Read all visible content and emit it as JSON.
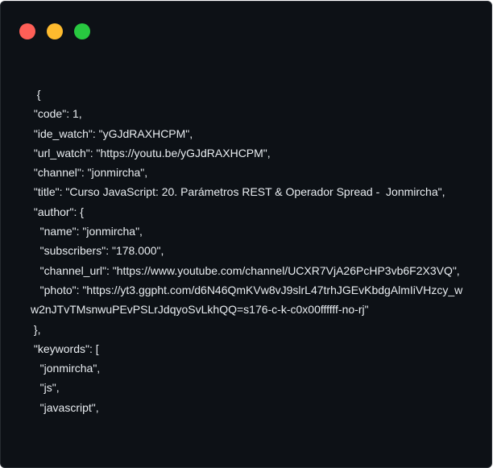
{
  "window": {
    "controls": [
      {
        "name": "close",
        "color": "#fe5f57"
      },
      {
        "name": "minimize",
        "color": "#febb2e"
      },
      {
        "name": "maximize",
        "color": "#28c840"
      }
    ]
  },
  "code_lines": [
    "  {",
    " \"code\": 1,",
    " \"ide_watch\": \"yGJdRAXHCPM\",",
    " \"url_watch\": \"https://youtu.be/yGJdRAXHCPM\",",
    " \"channel\": \"jonmircha\",",
    " \"title\": \"Curso JavaScript: 20. Parámetros REST & Operador Spread -  Jonmircha\",",
    " \"author\": {",
    "   \"name\": \"jonmircha\",",
    "   \"subscribers\": \"178.000\",",
    "   \"channel_url\": \"https://www.youtube.com/channel/UCXR7VjA26PcHP3vb6F2X3VQ\",",
    "   \"photo\": \"https://yt3.ggpht.com/d6N46QmKVw8vJ9slrL47trhJGEvKbdgAlmIiVHzcy_ww2nJTvTMsnwuPEvPSLrJdqyoSvLkhQQ=s176-c-k-c0x00ffffff-no-rj\"",
    " },",
    " \"keywords\": [",
    "   \"jonmircha\",",
    "   \"js\",",
    "   \"javascript\","
  ]
}
